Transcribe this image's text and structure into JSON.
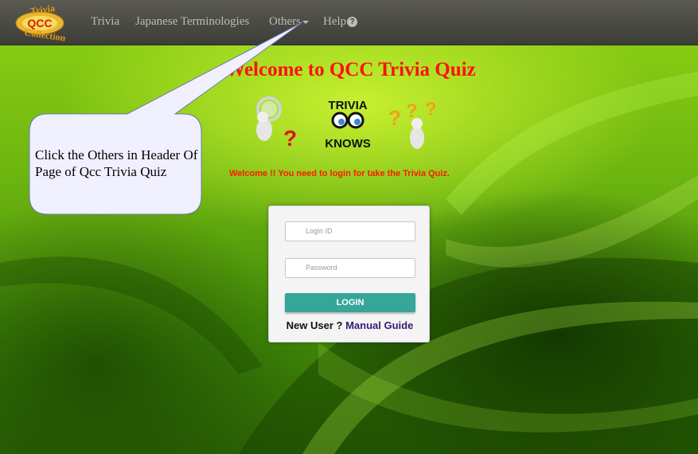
{
  "nav": {
    "logo_text": {
      "line1": "Trivia",
      "line2": "QCC",
      "line3": "Collection"
    },
    "items": [
      {
        "label": "Trivia"
      },
      {
        "label": "Japanese Terminologies"
      },
      {
        "label": "Others"
      },
      {
        "label": "Help"
      }
    ],
    "help_icon": "?"
  },
  "page": {
    "title": "Welcome to QCC Trivia Quiz",
    "illustration": {
      "sign_line1": "TRIVIA",
      "sign_line2": "KNOWS"
    },
    "login_message": "Welcome !! You need to login for take the Trivia Quiz."
  },
  "callout": {
    "text": "Click the Others in Header Of Page of Qcc Trivia Quiz"
  },
  "login_form": {
    "login_id_placeholder": "Login ID",
    "password_placeholder": "Password",
    "login_button": "LOGIN",
    "new_user_text": "New User ?",
    "manual_guide_link": "Manual Guide"
  },
  "colors": {
    "title_red": "#ff1010",
    "button_teal": "#36a59a",
    "navbar_dark": "#3c3d38",
    "link_purple": "#3a1a6e",
    "callout_fill": "#f0f0ff"
  }
}
